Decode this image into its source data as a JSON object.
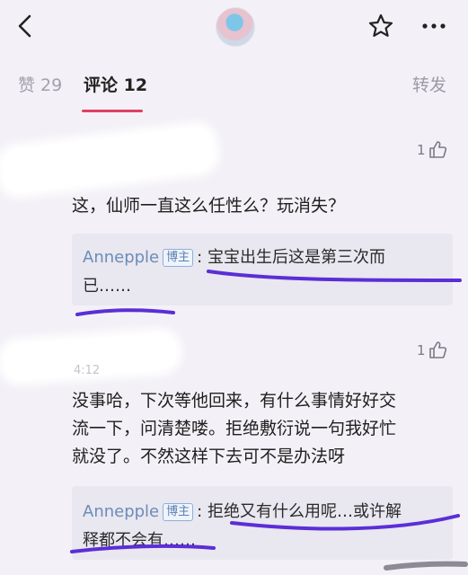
{
  "tabs": {
    "likes": "赞 29",
    "comments": "评论 12",
    "forward": "转发"
  },
  "comments": [
    {
      "likes": "1",
      "text": "这，仙师一直这么任性么？玩消失？",
      "reply": {
        "author": "Anneppl​e",
        "badge": "博主",
        "line1": ": 宝宝出生后这是第三次而",
        "line2": "已……"
      }
    },
    {
      "likes": "1",
      "time_partial": "4:12",
      "text_lines": [
        "没事哈，下次等他回来，有什么事情好好交",
        "流一下，问清楚喽。拒绝敷衍说一句我好忙",
        "就没了。不然这样下去可不是办法呀"
      ],
      "reply": {
        "author": "Anneppl​e",
        "badge": "博主",
        "line1": ": 拒绝又有什么用呢…或许解",
        "line2": "释都不会有……"
      }
    }
  ],
  "colors": {
    "accent": "#e04063",
    "scribble": "#5b2ed6",
    "background": "#f3f1f7",
    "reply_background": "#e9e7f0"
  },
  "icons": [
    "back-icon",
    "star-icon",
    "more-icon",
    "thumbs-up-icon"
  ]
}
